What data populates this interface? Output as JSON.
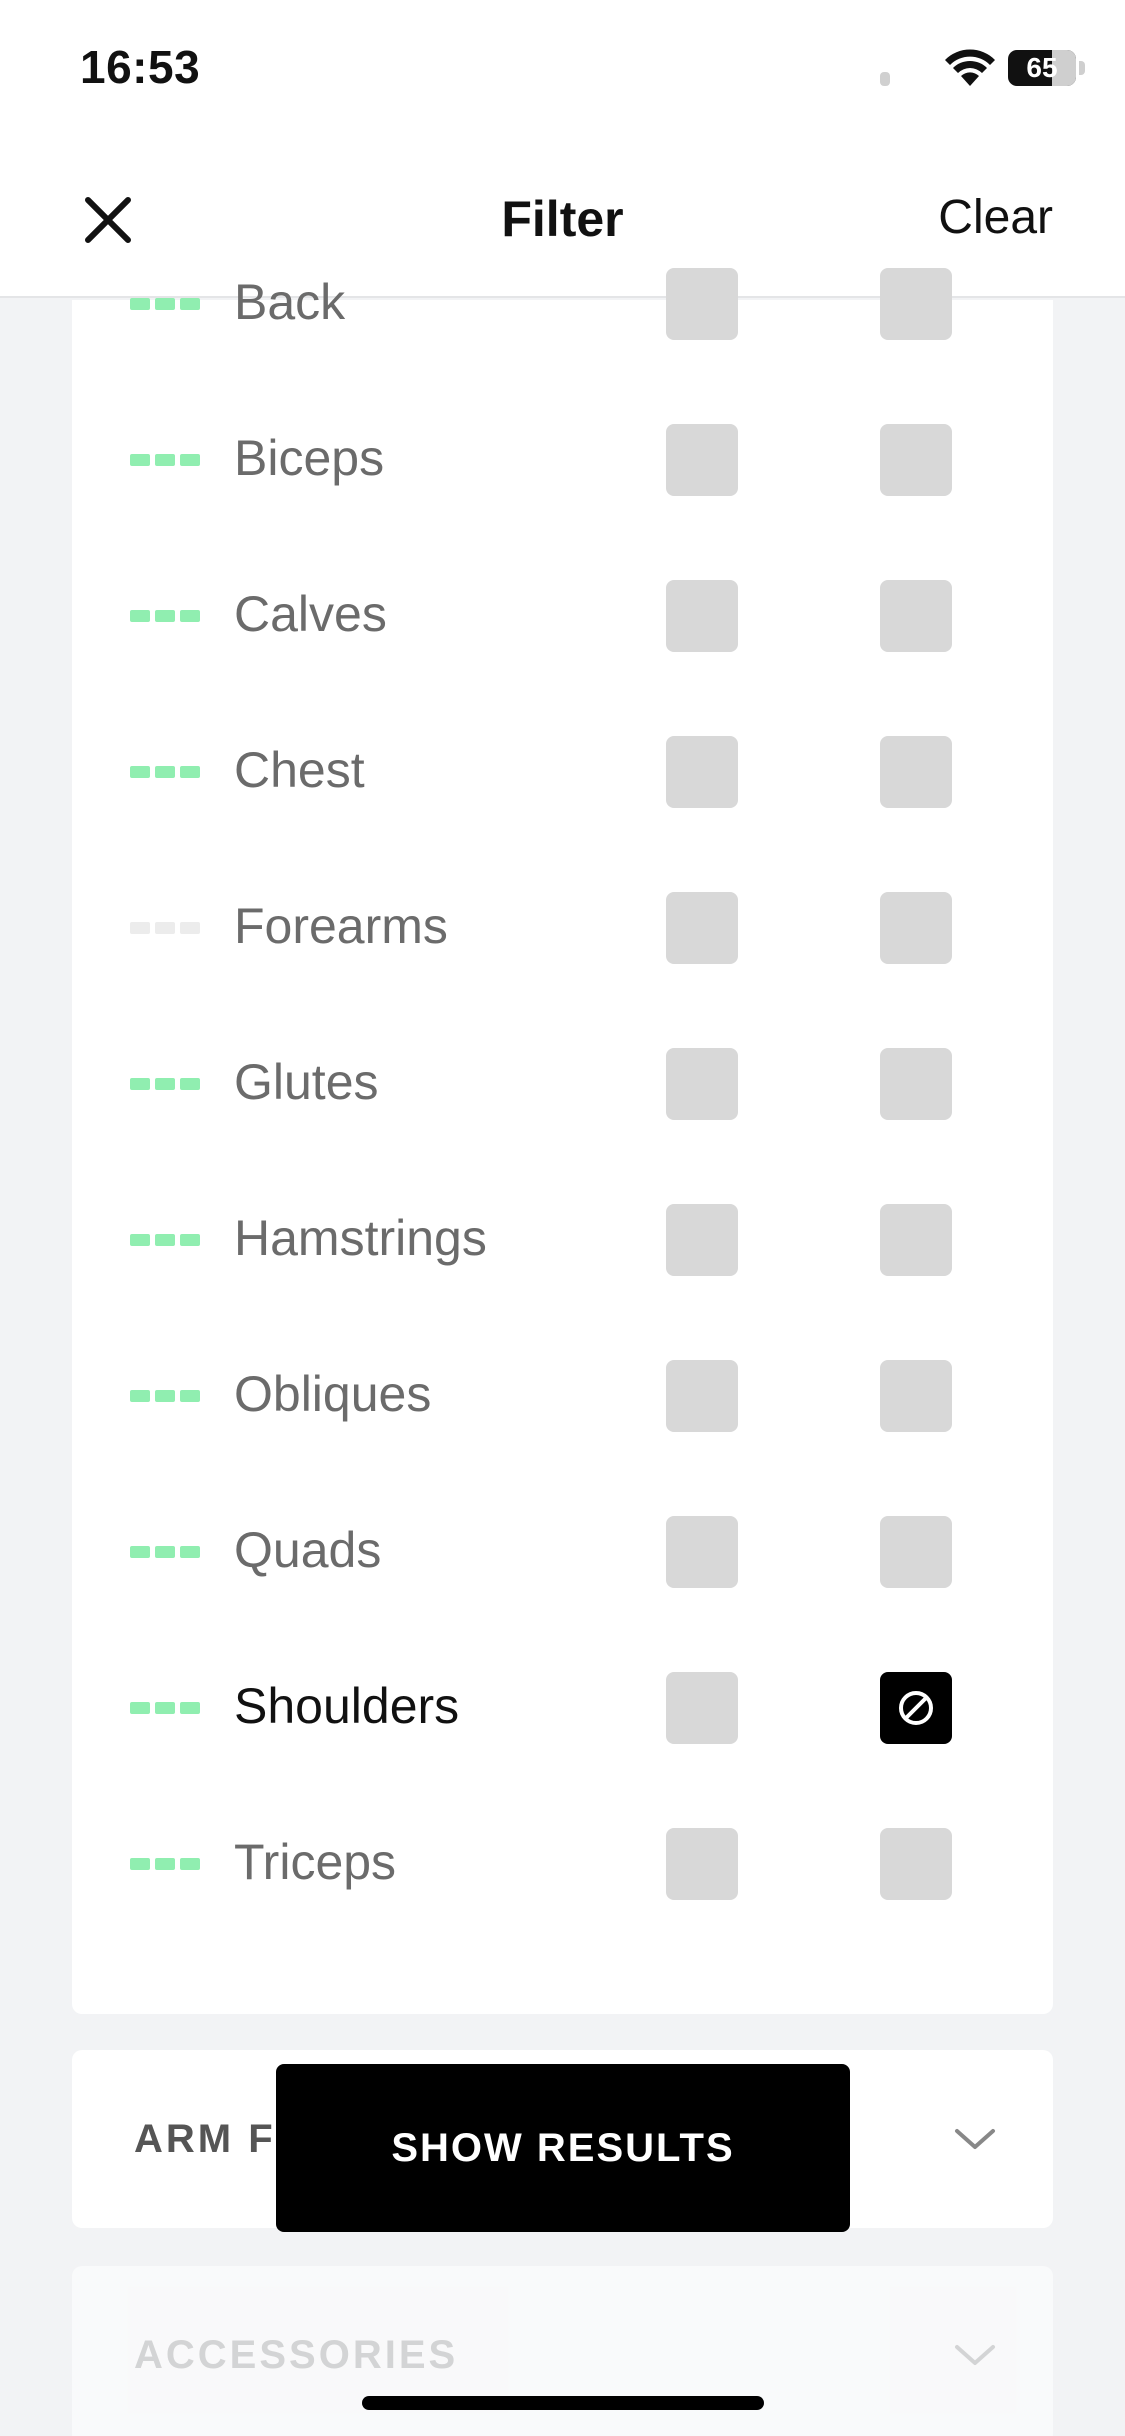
{
  "status_bar": {
    "time": "16:53",
    "battery_text": "65",
    "battery_level": 0.65
  },
  "nav": {
    "title": "Filter",
    "clear_label": "Clear",
    "close_icon": "close-icon"
  },
  "colors": {
    "indicator_active": "#90eeb0",
    "indicator_inactive": "#ececec",
    "checkbox_empty": "#d8d8d8",
    "checkbox_excluded": "#000000"
  },
  "muscles": [
    {
      "label": "Back",
      "indicator": "active",
      "col_a": "empty",
      "col_b": "empty"
    },
    {
      "label": "Biceps",
      "indicator": "active",
      "col_a": "empty",
      "col_b": "empty"
    },
    {
      "label": "Calves",
      "indicator": "active",
      "col_a": "empty",
      "col_b": "empty"
    },
    {
      "label": "Chest",
      "indicator": "active",
      "col_a": "empty",
      "col_b": "empty"
    },
    {
      "label": "Forearms",
      "indicator": "inactive",
      "col_a": "empty",
      "col_b": "empty"
    },
    {
      "label": "Glutes",
      "indicator": "active",
      "col_a": "empty",
      "col_b": "empty"
    },
    {
      "label": "Hamstrings",
      "indicator": "active",
      "col_a": "empty",
      "col_b": "empty"
    },
    {
      "label": "Obliques",
      "indicator": "active",
      "col_a": "empty",
      "col_b": "empty"
    },
    {
      "label": "Quads",
      "indicator": "active",
      "col_a": "empty",
      "col_b": "empty"
    },
    {
      "label": "Shoulders",
      "indicator": "active",
      "col_a": "empty",
      "col_b": "excluded"
    },
    {
      "label": "Triceps",
      "indicator": "active",
      "col_a": "empty",
      "col_b": "empty"
    }
  ],
  "sections": [
    {
      "title": "ARM F",
      "icon": "chevron-down-icon"
    },
    {
      "title": "ACCESSORIES",
      "icon": "chevron-down-icon"
    }
  ],
  "show_results_label": "SHOW RESULTS"
}
